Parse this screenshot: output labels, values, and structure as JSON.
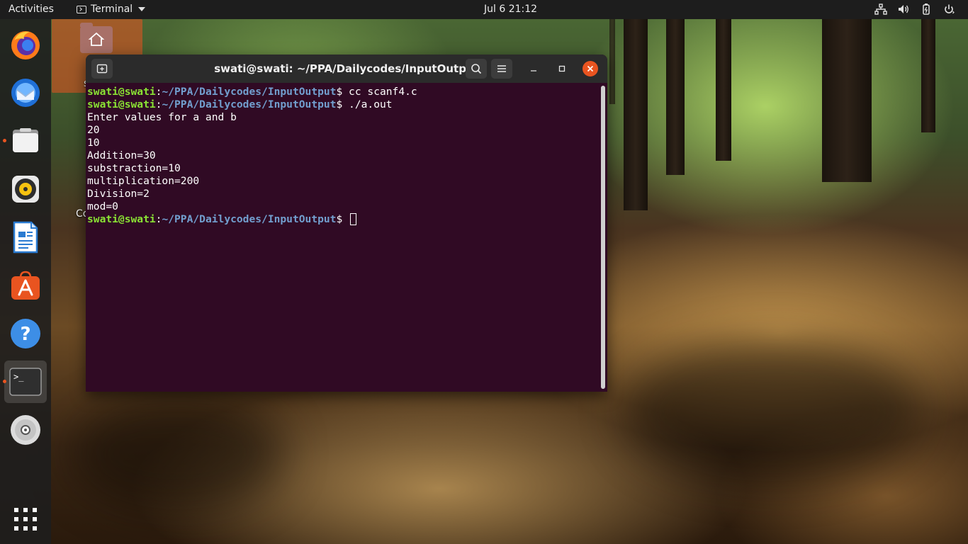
{
  "topbar": {
    "activities": "Activities",
    "app_menu_label": "Terminal",
    "clock": "Jul 6  21:12",
    "tray_icons": [
      "network-icon",
      "volume-icon",
      "battery-icon",
      "power-icon"
    ]
  },
  "dock": {
    "items": [
      {
        "name": "firefox",
        "icon": "firefox-icon",
        "running": false
      },
      {
        "name": "thunderbird",
        "icon": "thunderbird-icon",
        "running": false
      },
      {
        "name": "files",
        "icon": "files-icon",
        "running": true
      },
      {
        "name": "rhythmbox",
        "icon": "rhythmbox-icon",
        "running": false
      },
      {
        "name": "libreoffice-writer",
        "icon": "writer-icon",
        "running": false
      },
      {
        "name": "ubuntu-software",
        "icon": "software-icon",
        "running": false
      },
      {
        "name": "help",
        "icon": "help-icon",
        "running": false
      },
      {
        "name": "terminal",
        "icon": "terminal-icon",
        "running": true,
        "active": true
      },
      {
        "name": "disc",
        "icon": "disc-icon",
        "running": false
      },
      {
        "name": "show-applications",
        "icon": "grid-icon",
        "running": false
      }
    ],
    "terminal_glyph": ">_",
    "help_glyph": "?"
  },
  "desktop": {
    "label_fragment_1": "s",
    "label_fragment_2": "Co"
  },
  "window": {
    "title": "swati@swati: ~/PPA/Dailycodes/InputOutput",
    "prompt_user": "swati@swati",
    "prompt_sep": ":",
    "prompt_path": "~/PPA/Dailycodes/InputOutput",
    "prompt_symbol": "$ ",
    "lines": [
      {
        "type": "prompt",
        "cmd": "cc scanf4.c"
      },
      {
        "type": "prompt",
        "cmd": "./a.out"
      },
      {
        "type": "out",
        "text": "Enter values for a and b"
      },
      {
        "type": "out",
        "text": "20"
      },
      {
        "type": "out",
        "text": "10"
      },
      {
        "type": "out",
        "text": "Addition=30"
      },
      {
        "type": "out",
        "text": "substraction=10"
      },
      {
        "type": "out",
        "text": "multiplication=200"
      },
      {
        "type": "out",
        "text": "Division=2"
      },
      {
        "type": "out",
        "text": "mod=0"
      },
      {
        "type": "prompt",
        "cmd": "",
        "cursor": true
      }
    ],
    "colors": {
      "background": "#300a24",
      "user": "#8ae234",
      "path": "#729fcf",
      "close": "#e95420"
    }
  }
}
